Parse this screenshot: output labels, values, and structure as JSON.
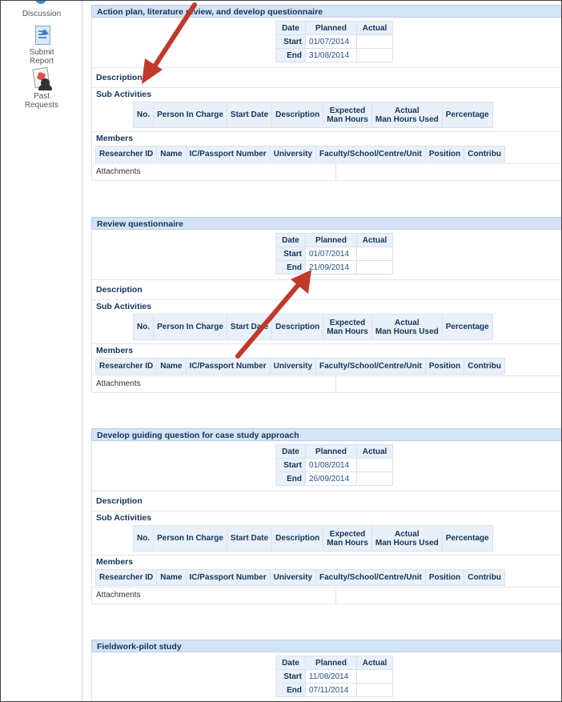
{
  "nav": {
    "discussion_label": "Discussion",
    "submit_report_label": [
      "Submit",
      "Report"
    ],
    "past_requests_label": [
      "Past",
      "Requests"
    ]
  },
  "dates_table": {
    "date_header": "Date",
    "planned_header": "Planned",
    "actual_header": "Actual",
    "start_label": "Start",
    "end_label": "End"
  },
  "labels": {
    "description": "Description",
    "sub_activities": "Sub Activities",
    "members": "Members",
    "attachments": "Attachments"
  },
  "sub_activity_columns": [
    "No.",
    "Person In Charge",
    "Start Date",
    "Description",
    "Expected\nMan Hours",
    "Actual\nMan Hours Used",
    "Percentage"
  ],
  "member_columns": [
    "Researcher ID",
    "Name",
    "IC/Passport Number",
    "University",
    "Faculty/School/Centre/Unit",
    "Position",
    "Contribu"
  ],
  "activities": [
    {
      "title": "Action plan, literature review, and develop questionnaire",
      "start": "01/07/2014",
      "end": "31/08/2014"
    },
    {
      "title": "Review questionnaire",
      "start": "01/07/2014",
      "end": "21/09/2014"
    },
    {
      "title": "Develop guiding question for case study approach",
      "start": "01/08/2014",
      "end": "26/09/2014"
    },
    {
      "title": "Fieldwork-pilot study",
      "start": "11/08/2014",
      "end": "07/11/2014"
    }
  ],
  "colors": {
    "header_bg": "#d4e3f5",
    "cell_header_bg": "#e9f0f9",
    "annotation_arrow": "#c0392b"
  }
}
